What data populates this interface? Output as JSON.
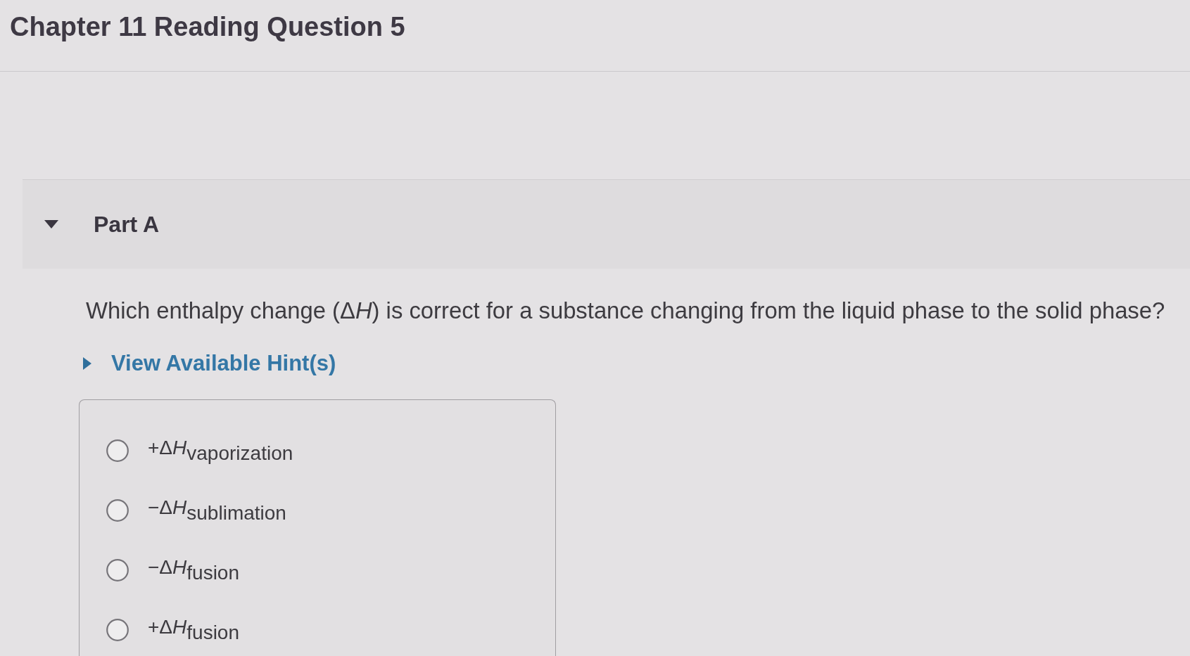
{
  "page": {
    "title": "Chapter 11 Reading Question 5"
  },
  "part": {
    "title": "Part A",
    "expanded": true,
    "question": {
      "before": "Which enthalpy change (Δ",
      "symbol": "H",
      "after": ") is correct for a substance changing from the liquid phase to the solid phase?"
    },
    "hint_link": {
      "label": "View Available Hint(s)",
      "expanded": false
    },
    "options": [
      {
        "prefix": "+Δ",
        "symbol": "H",
        "subscript": "vaporization",
        "selected": false
      },
      {
        "prefix": "−Δ",
        "symbol": "H",
        "subscript": "sublimation",
        "selected": false
      },
      {
        "prefix": "−Δ",
        "symbol": "H",
        "subscript": "fusion",
        "selected": false
      },
      {
        "prefix": "+Δ",
        "symbol": "H",
        "subscript": "fusion",
        "selected": false
      }
    ]
  }
}
